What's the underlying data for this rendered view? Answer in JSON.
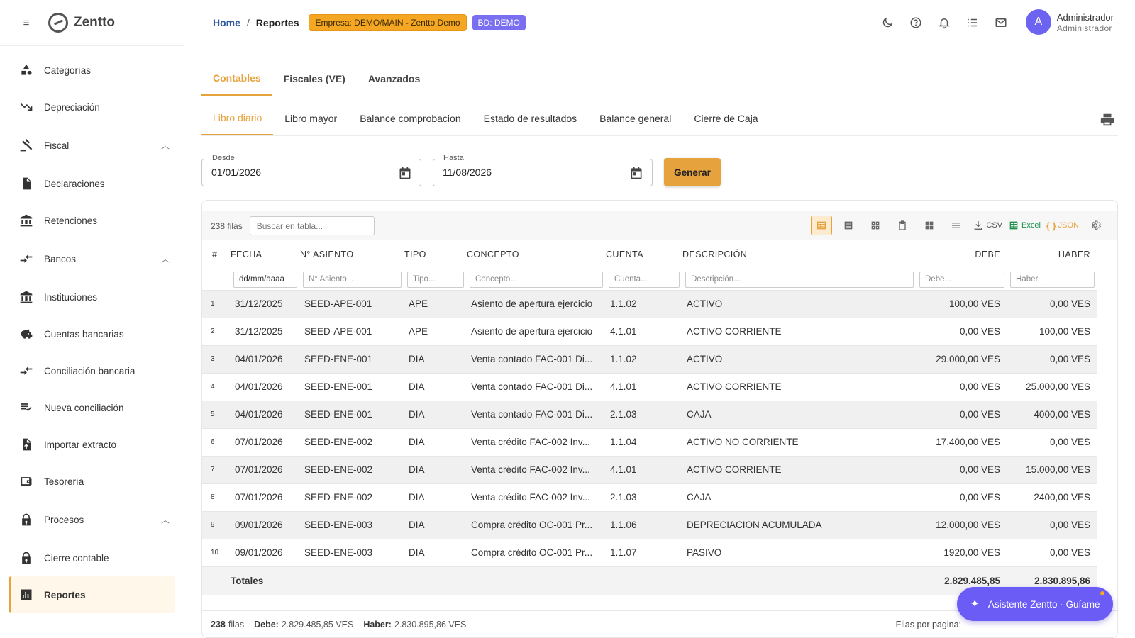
{
  "app": {
    "name": "Zentto"
  },
  "sidebar": {
    "items": [
      {
        "label": "Categorías",
        "icon": "shapes-icon",
        "type": "item"
      },
      {
        "label": "Depreciación",
        "icon": "trending-down-icon",
        "type": "item"
      },
      {
        "label": "Fiscal",
        "icon": "gavel-icon",
        "type": "group",
        "expanded": true
      },
      {
        "label": "Declaraciones",
        "icon": "document-icon",
        "type": "item"
      },
      {
        "label": "Retenciones",
        "icon": "bank-icon",
        "type": "item"
      },
      {
        "label": "Bancos",
        "icon": "compare-arrows-icon",
        "type": "group",
        "expanded": true
      },
      {
        "label": "Instituciones",
        "icon": "bank-icon",
        "type": "item"
      },
      {
        "label": "Cuentas bancarias",
        "icon": "piggy-bank-icon",
        "type": "item"
      },
      {
        "label": "Conciliación bancaria",
        "icon": "compare-arrows-icon",
        "type": "item"
      },
      {
        "label": "Nueva conciliación",
        "icon": "checklist-icon",
        "type": "item"
      },
      {
        "label": "Importar extracto",
        "icon": "file-upload-icon",
        "type": "item"
      },
      {
        "label": "Tesorería",
        "icon": "wallet-icon",
        "type": "item"
      },
      {
        "label": "Procesos",
        "icon": "lock-icon",
        "type": "group",
        "expanded": true
      },
      {
        "label": "Cierre contable",
        "icon": "lock-icon",
        "type": "item"
      },
      {
        "label": "Reportes",
        "icon": "bar-chart-icon",
        "type": "item",
        "active": true
      }
    ]
  },
  "header": {
    "breadcrumb_home": "Home",
    "breadcrumb_sep": "/",
    "breadcrumb_current": "Reportes",
    "empresa_chip": "Empresa: DEMO/MAIN - Zentto Demo",
    "bd_chip": "BD: DEMO",
    "user_initial": "A",
    "user_name": "Administrador",
    "user_role": "Administrador"
  },
  "tabs_main": [
    "Contables",
    "Fiscales (VE)",
    "Avanzados"
  ],
  "tabs_sub": [
    "Libro diario",
    "Libro mayor",
    "Balance comprobacion",
    "Estado de resultados",
    "Balance general",
    "Cierre de Caja"
  ],
  "filters": {
    "desde_label": "Desde",
    "desde_value": "01/01/2026",
    "hasta_label": "Hasta",
    "hasta_value": "11/08/2026",
    "generate_label": "Generar"
  },
  "grid": {
    "row_count": "238 filas",
    "search_placeholder": "Buscar en tabla...",
    "csv_label": "CSV",
    "excel_label": "Excel",
    "json_label": "JSON",
    "columns": [
      "#",
      "FECHA",
      "N° ASIENTO",
      "TIPO",
      "CONCEPTO",
      "CUENTA",
      "DESCRIPCIÓN",
      "DEBE",
      "HABER"
    ],
    "filter_placeholders": [
      "dd/mm/aaaa",
      "N° Asiento...",
      "Tipo...",
      "Concepto...",
      "Cuenta...",
      "Descripción...",
      "Debe...",
      "Haber..."
    ],
    "rows": [
      [
        "1",
        "31/12/2025",
        "SEED-APE-001",
        "APE",
        "Asiento de apertura ejercicio",
        "1.1.02",
        "ACTIVO",
        "100,00 VES",
        "0,00 VES"
      ],
      [
        "2",
        "31/12/2025",
        "SEED-APE-001",
        "APE",
        "Asiento de apertura ejercicio",
        "4.1.01",
        "ACTIVO CORRIENTE",
        "0,00 VES",
        "100,00 VES"
      ],
      [
        "3",
        "04/01/2026",
        "SEED-ENE-001",
        "DIA",
        "Venta contado FAC-001 Di...",
        "1.1.02",
        "ACTIVO",
        "29.000,00 VES",
        "0,00 VES"
      ],
      [
        "4",
        "04/01/2026",
        "SEED-ENE-001",
        "DIA",
        "Venta contado FAC-001 Di...",
        "4.1.01",
        "ACTIVO CORRIENTE",
        "0,00 VES",
        "25.000,00 VES"
      ],
      [
        "5",
        "04/01/2026",
        "SEED-ENE-001",
        "DIA",
        "Venta contado FAC-001 Di...",
        "2.1.03",
        "CAJA",
        "0,00 VES",
        "4000,00 VES"
      ],
      [
        "6",
        "07/01/2026",
        "SEED-ENE-002",
        "DIA",
        "Venta crédito FAC-002 Inv...",
        "1.1.04",
        "ACTIVO NO CORRIENTE",
        "17.400,00 VES",
        "0,00 VES"
      ],
      [
        "7",
        "07/01/2026",
        "SEED-ENE-002",
        "DIA",
        "Venta crédito FAC-002 Inv...",
        "4.1.01",
        "ACTIVO CORRIENTE",
        "0,00 VES",
        "15.000,00 VES"
      ],
      [
        "8",
        "07/01/2026",
        "SEED-ENE-002",
        "DIA",
        "Venta crédito FAC-002 Inv...",
        "2.1.03",
        "CAJA",
        "0,00 VES",
        "2400,00 VES"
      ],
      [
        "9",
        "09/01/2026",
        "SEED-ENE-003",
        "DIA",
        "Compra crédito OC-001 Pr...",
        "1.1.06",
        "DEPRECIACION ACUMULADA",
        "12.000,00 VES",
        "0,00 VES"
      ],
      [
        "10",
        "09/01/2026",
        "SEED-ENE-003",
        "DIA",
        "Compra crédito OC-001 Pr...",
        "1.1.07",
        "PASIVO",
        "1920,00 VES",
        "0,00 VES"
      ]
    ],
    "totals_label": "Totales",
    "totals_debe": "2.829.485,85",
    "totals_haber": "2.830.895,86"
  },
  "footer": {
    "count_value": "238",
    "count_label": "filas",
    "debe_label": "Debe:",
    "debe_value": "2.829.485,85 VES",
    "haber_label": "Haber:",
    "haber_value": "2.830.895,86 VES",
    "rows_per_page_label": "Filas por pagina:"
  },
  "assistant": {
    "label": "Asistente Zentto · Guíame"
  },
  "colors": {
    "accent": "#e6a23c",
    "brand_purple": "#6a5cf5",
    "chip_orange": "#f5a623"
  }
}
